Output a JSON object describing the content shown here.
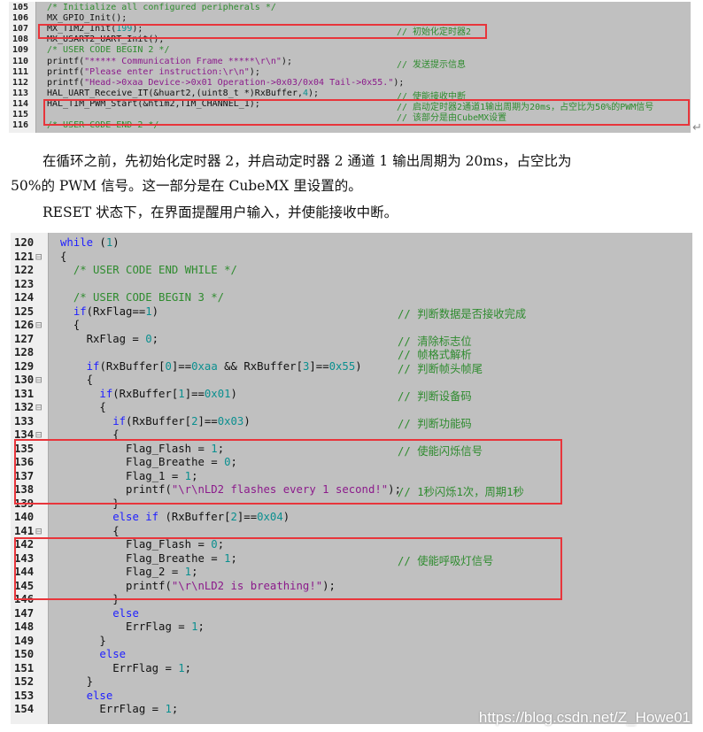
{
  "block1": {
    "lines": [
      {
        "n": "105",
        "code": [
          [
            "cm",
            "/* Initialize all configured peripherals */"
          ]
        ],
        "comment": ""
      },
      {
        "n": "106",
        "code": [
          [
            "",
            "MX_GPIO_Init();"
          ]
        ],
        "comment": ""
      },
      {
        "n": "107",
        "code": [
          [
            "",
            "MX_TIM2_Init("
          ],
          [
            "nm",
            "199"
          ],
          [
            "",
            ");"
          ]
        ],
        "comment": "// 初始化定时器2"
      },
      {
        "n": "108",
        "code": [
          [
            "",
            "MX_USART2_UART_Init();"
          ]
        ],
        "comment": ""
      },
      {
        "n": "109",
        "code": [
          [
            "cm",
            "/* USER CODE BEGIN 2 */"
          ]
        ],
        "comment": ""
      },
      {
        "n": "110",
        "code": [
          [
            "",
            "printf("
          ],
          [
            "st",
            "\"***** Communication Frame *****\\r\\n\""
          ],
          [
            "",
            ");"
          ]
        ],
        "comment": "// 发送提示信息"
      },
      {
        "n": "111",
        "code": [
          [
            "",
            "printf("
          ],
          [
            "st",
            "\"Please enter instruction:\\r\\n\""
          ],
          [
            "",
            ");"
          ]
        ],
        "comment": ""
      },
      {
        "n": "112",
        "code": [
          [
            "",
            "printf("
          ],
          [
            "st",
            "\"Head->0xaa Device->0x01 Operation->0x03/0x04 Tail->0x55.\""
          ],
          [
            "",
            ");"
          ]
        ],
        "comment": ""
      },
      {
        "n": "113",
        "code": [
          [
            "",
            "HAL_UART_Receive_IT(&huart2,(uint8_t *)RxBuffer,"
          ],
          [
            "nm",
            "4"
          ],
          [
            "",
            ");"
          ]
        ],
        "comment": "// 使能接收中断"
      },
      {
        "n": "114",
        "code": [
          [
            "",
            "HAL_TIM_PWM_Start(&htim2,TIM_CHANNEL_1);"
          ]
        ],
        "comment": "// 启动定时器2通道1输出周期为20ms，占空比为50%的PWM信号"
      },
      {
        "n": "115",
        "code": [],
        "comment": "// 该部分是由CubeMX设置"
      },
      {
        "n": "116",
        "code": [
          [
            "cm",
            "/* USER CODE END 2 */"
          ]
        ],
        "comment": ""
      }
    ]
  },
  "paragraphs": [
    "在循环之前，先初始化定时器 2，并启动定时器 2 通道 1 输出周期为 20ms，占空比为",
    "50%的 PWM 信号。这一部分是在 CubeMX 里设置的。",
    "RESET 状态下，在界面提醒用户输入，并使能接收中断。"
  ],
  "return_mark": "↵",
  "block2": {
    "lines": [
      {
        "n": "120",
        "code": [
          [
            "kw",
            "while"
          ],
          [
            "",
            " ("
          ],
          [
            "nm",
            "1"
          ],
          [
            "",
            ")"
          ]
        ],
        "comment": ""
      },
      {
        "n": "121",
        "fold": true,
        "code": [
          [
            "",
            "{"
          ]
        ],
        "comment": ""
      },
      {
        "n": "122",
        "code": [
          [
            "",
            "  "
          ],
          [
            "cm",
            "/* USER CODE END WHILE */"
          ]
        ],
        "comment": ""
      },
      {
        "n": "123",
        "code": [],
        "comment": ""
      },
      {
        "n": "124",
        "code": [
          [
            "",
            "  "
          ],
          [
            "cm",
            "/* USER CODE BEGIN 3 */"
          ]
        ],
        "comment": ""
      },
      {
        "n": "125",
        "code": [
          [
            "",
            "  "
          ],
          [
            "kw",
            "if"
          ],
          [
            "",
            "(RxFlag=="
          ],
          [
            "nm",
            "1"
          ],
          [
            "",
            ")"
          ]
        ],
        "comment": "// 判断数据是否接收完成"
      },
      {
        "n": "126",
        "fold": true,
        "code": [
          [
            "",
            "  {"
          ]
        ],
        "comment": ""
      },
      {
        "n": "127",
        "code": [
          [
            "",
            "    RxFlag = "
          ],
          [
            "nm",
            "0"
          ],
          [
            "",
            ";"
          ]
        ],
        "comment": "// 清除标志位"
      },
      {
        "n": "128",
        "code": [],
        "comment": "// 帧格式解析"
      },
      {
        "n": "129",
        "code": [
          [
            "",
            "    "
          ],
          [
            "kw",
            "if"
          ],
          [
            "",
            "(RxBuffer["
          ],
          [
            "nm",
            "0"
          ],
          [
            "",
            "]=="
          ],
          [
            "nm",
            "0xaa"
          ],
          [
            "",
            " && RxBuffer["
          ],
          [
            "nm",
            "3"
          ],
          [
            "",
            "]=="
          ],
          [
            "nm",
            "0x55"
          ],
          [
            "",
            ")"
          ]
        ],
        "comment": "// 判断帧头帧尾"
      },
      {
        "n": "130",
        "fold": true,
        "code": [
          [
            "",
            "    {"
          ]
        ],
        "comment": ""
      },
      {
        "n": "131",
        "code": [
          [
            "",
            "      "
          ],
          [
            "kw",
            "if"
          ],
          [
            "",
            "(RxBuffer["
          ],
          [
            "nm",
            "1"
          ],
          [
            "",
            "]=="
          ],
          [
            "nm",
            "0x01"
          ],
          [
            "",
            ")"
          ]
        ],
        "comment": "// 判断设备码"
      },
      {
        "n": "132",
        "fold": true,
        "code": [
          [
            "",
            "      {"
          ]
        ],
        "comment": ""
      },
      {
        "n": "133",
        "code": [
          [
            "",
            "        "
          ],
          [
            "kw",
            "if"
          ],
          [
            "",
            "(RxBuffer["
          ],
          [
            "nm",
            "2"
          ],
          [
            "",
            "]=="
          ],
          [
            "nm",
            "0x03"
          ],
          [
            "",
            ")"
          ]
        ],
        "comment": "// 判断功能码"
      },
      {
        "n": "134",
        "fold": true,
        "code": [
          [
            "",
            "        {"
          ]
        ],
        "comment": ""
      },
      {
        "n": "135",
        "code": [
          [
            "",
            "          Flag_Flash = "
          ],
          [
            "nm",
            "1"
          ],
          [
            "",
            ";"
          ]
        ],
        "comment": "// 使能闪烁信号"
      },
      {
        "n": "136",
        "code": [
          [
            "",
            "          Flag_Breathe = "
          ],
          [
            "nm",
            "0"
          ],
          [
            "",
            ";"
          ]
        ],
        "comment": ""
      },
      {
        "n": "137",
        "code": [
          [
            "",
            "          Flag_1 = "
          ],
          [
            "nm",
            "1"
          ],
          [
            "",
            ";"
          ]
        ],
        "comment": ""
      },
      {
        "n": "138",
        "code": [
          [
            "",
            "          printf("
          ],
          [
            "st",
            "\"\\r\\nLD2 flashes every 1 second!\""
          ],
          [
            "",
            ");"
          ]
        ],
        "comment": "// 1秒闪烁1次，周期1秒"
      },
      {
        "n": "139",
        "code": [
          [
            "",
            "        }"
          ]
        ],
        "comment": ""
      },
      {
        "n": "140",
        "code": [
          [
            "",
            "        "
          ],
          [
            "kw",
            "else if"
          ],
          [
            "",
            " (RxBuffer["
          ],
          [
            "nm",
            "2"
          ],
          [
            "",
            "]=="
          ],
          [
            "nm",
            "0x04"
          ],
          [
            "",
            ")"
          ]
        ],
        "comment": ""
      },
      {
        "n": "141",
        "fold": true,
        "code": [
          [
            "",
            "        {"
          ]
        ],
        "comment": ""
      },
      {
        "n": "142",
        "code": [
          [
            "",
            "          Flag_Flash = "
          ],
          [
            "nm",
            "0"
          ],
          [
            "",
            ";"
          ]
        ],
        "comment": ""
      },
      {
        "n": "143",
        "code": [
          [
            "",
            "          Flag_Breathe = "
          ],
          [
            "nm",
            "1"
          ],
          [
            "",
            ";"
          ]
        ],
        "comment": "// 使能呼吸灯信号"
      },
      {
        "n": "144",
        "code": [
          [
            "",
            "          Flag_2 = "
          ],
          [
            "nm",
            "1"
          ],
          [
            "",
            ";"
          ]
        ],
        "comment": ""
      },
      {
        "n": "145",
        "code": [
          [
            "",
            "          printf("
          ],
          [
            "st",
            "\"\\r\\nLD2 is breathing!\""
          ],
          [
            "",
            ");"
          ]
        ],
        "comment": ""
      },
      {
        "n": "146",
        "code": [
          [
            "",
            "        }"
          ]
        ],
        "comment": ""
      },
      {
        "n": "147",
        "code": [
          [
            "",
            "        "
          ],
          [
            "kw",
            "else"
          ]
        ],
        "comment": ""
      },
      {
        "n": "148",
        "code": [
          [
            "",
            "          ErrFlag = "
          ],
          [
            "nm",
            "1"
          ],
          [
            "",
            ";"
          ]
        ],
        "comment": ""
      },
      {
        "n": "149",
        "code": [
          [
            "",
            "      }"
          ]
        ],
        "comment": ""
      },
      {
        "n": "150",
        "code": [
          [
            "",
            "      "
          ],
          [
            "kw",
            "else"
          ]
        ],
        "comment": ""
      },
      {
        "n": "151",
        "code": [
          [
            "",
            "        ErrFlag = "
          ],
          [
            "nm",
            "1"
          ],
          [
            "",
            ";"
          ]
        ],
        "comment": ""
      },
      {
        "n": "152",
        "code": [
          [
            "",
            "    }"
          ]
        ],
        "comment": ""
      },
      {
        "n": "153",
        "code": [
          [
            "",
            "    "
          ],
          [
            "kw",
            "else"
          ]
        ],
        "comment": ""
      },
      {
        "n": "154",
        "code": [
          [
            "",
            "      ErrFlag = "
          ],
          [
            "nm",
            "1"
          ],
          [
            "",
            ";"
          ]
        ],
        "comment": ""
      }
    ]
  },
  "watermark": "https://blog.csdn.net/Z_Howe01",
  "colors": {
    "highlight_box": "#e8353b",
    "code_bg": "#c0c0c0"
  }
}
